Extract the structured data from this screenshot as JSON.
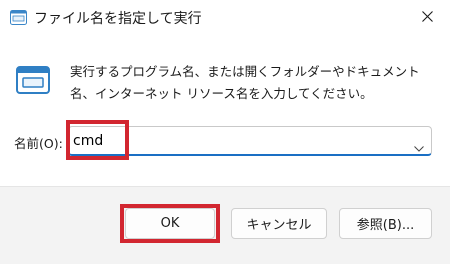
{
  "window": {
    "title": "ファイル名を指定して実行",
    "icon": "run-dialog-icon",
    "close_icon": "close-icon"
  },
  "description": "実行するプログラム名、または開くフォルダーやドキュメント名、インターネット リソース名を入力してください。",
  "name_field": {
    "label": "名前(O):",
    "value": "cmd",
    "dropdown_icon": "chevron-down-icon"
  },
  "buttons": {
    "ok": "OK",
    "cancel": "キャンセル",
    "browse": "参照(B)..."
  },
  "colors": {
    "highlight": "#d22630",
    "accent": "#1a6fc4",
    "footer_background": "#f3f3f3"
  }
}
